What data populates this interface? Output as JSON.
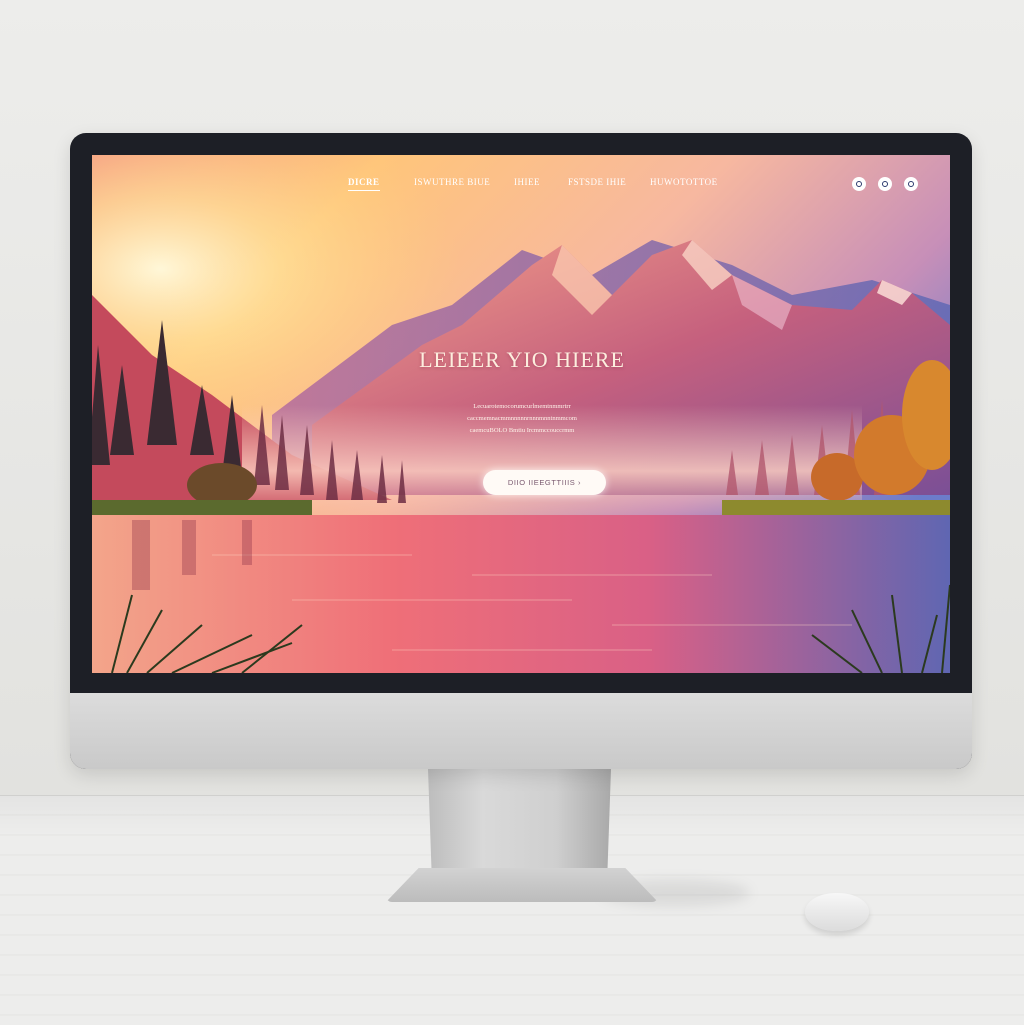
{
  "site": {
    "nav": [
      {
        "label": "DICRE",
        "active": true
      },
      {
        "label": "ISWUTHRE   BIUE",
        "active": false
      },
      {
        "label": "IHIEE",
        "active": false
      },
      {
        "label": "FSTSDE IHIE",
        "active": false
      },
      {
        "label": "HUWOTOTTOE",
        "active": false
      }
    ],
    "social_icons": [
      "social-icon",
      "social-icon",
      "social-icon"
    ],
    "hero": {
      "title": "LEIEER YIO HIERE",
      "text": "Lecuarotemocorumcurlmemtnmmrtrr\ncaccmemnacmmnnnnnrnnnmnntnmmcom\ncaemcuBOLO Bmtiu Ircmmccouccrmm",
      "cta": "DIIO IIEEGTTIIIS  ›"
    }
  },
  "colors": {
    "sky_top": "#f08a7e",
    "sky_glow": "#ffd37a",
    "sky_right": "#6a78c8",
    "mountain": "#b8557e",
    "water": "#e46a6e"
  }
}
